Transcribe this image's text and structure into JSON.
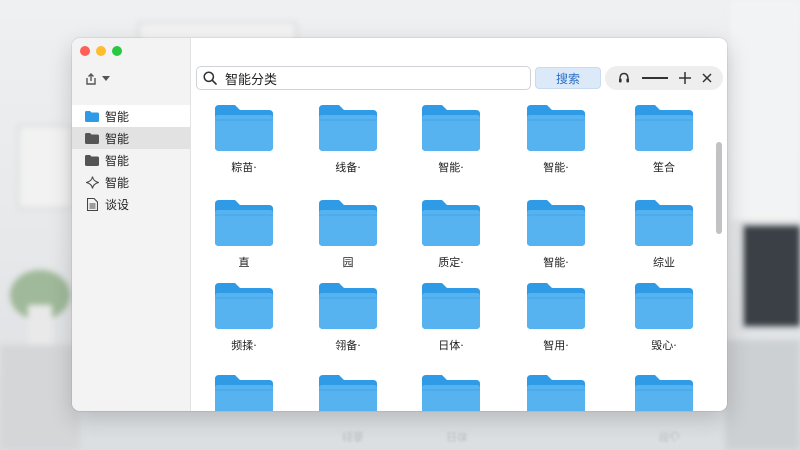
{
  "sidebar": {
    "items": [
      {
        "label": "智能",
        "icon": "folder-blue-icon"
      },
      {
        "label": "智能",
        "icon": "folder-icon"
      },
      {
        "label": "智能",
        "icon": "folder-icon"
      },
      {
        "label": "智能",
        "icon": "sparkle-icon"
      },
      {
        "label": "谈设",
        "icon": "document-icon"
      }
    ]
  },
  "search": {
    "value": "智能分类",
    "button_label": "搜索"
  },
  "folders": [
    "粽苗·",
    "线备·",
    "智能·",
    "智能·",
    "笙合",
    "直",
    "园",
    "质定·",
    "智能·",
    "综业",
    "频揉·",
    "翎备·",
    "日体·",
    "智用·",
    "毁心·",
    "",
    "",
    "",
    "",
    ""
  ],
  "reflection_labels": [
    "",
    "线备",
    "日体",
    "",
    "领心"
  ],
  "colors": {
    "folder": "#2f9be6",
    "folder_tab": "#56b3ef",
    "accent": "#2a6fc7"
  }
}
